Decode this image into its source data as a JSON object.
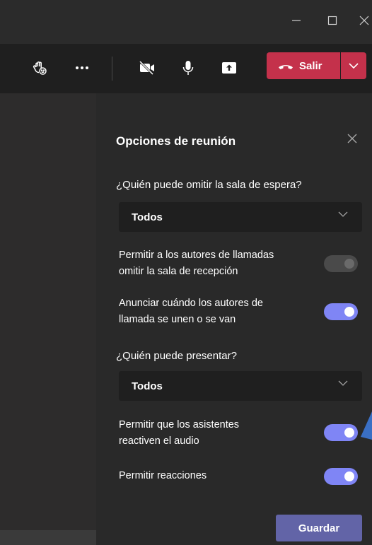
{
  "toolbar": {
    "leave_label": "Salir",
    "icons": [
      "raise-hand-icon",
      "more-options-icon",
      "camera-off-icon",
      "microphone-icon",
      "share-screen-icon",
      "phone-hangup-icon",
      "chevron-down-icon"
    ]
  },
  "window_controls": [
    "minimize",
    "maximize",
    "close"
  ],
  "panel": {
    "title": "Opciones de reunión",
    "bypass_lobby": {
      "label": "¿Quién puede omitir la sala de espera?",
      "value": "Todos"
    },
    "callers_bypass": {
      "label": "Permitir a los autores de llamadas omitir la sala de recepción",
      "line1": "Permitir a los autores de llamadas",
      "line2": "omitir la sala de recepción",
      "enabled": false
    },
    "announce": {
      "label": "Anunciar cuándo los autores de llamada se unen o se van",
      "line1": "Anunciar cuándo los autores de",
      "line2": "llamada se unen o se van",
      "enabled": true
    },
    "presenters": {
      "label": "¿Quién puede presentar?",
      "value": "Todos"
    },
    "unmute": {
      "line1": "Permitir que los asistentes",
      "line2": "reactiven el audio",
      "enabled": true
    },
    "reactions": {
      "label": "Permitir reacciones",
      "enabled": true
    },
    "save_label": "Guardar"
  },
  "colors": {
    "leave": "#c4314b",
    "toggle_on": "#7f85f5",
    "save": "#6264a7"
  }
}
